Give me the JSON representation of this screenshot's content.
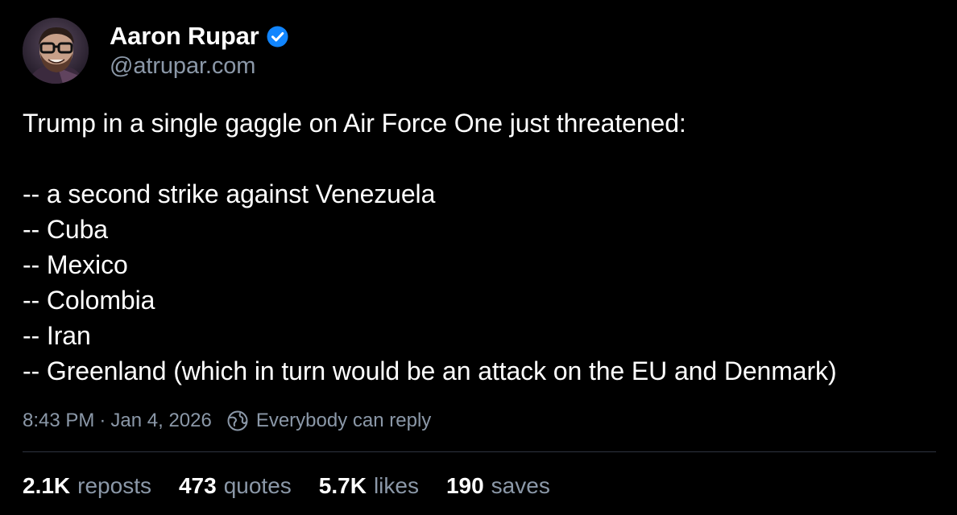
{
  "author": {
    "display_name": "Aaron Rupar",
    "handle": "@atrupar.com",
    "verified": true,
    "verified_color": "#1185fe"
  },
  "post": {
    "lines": [
      "Trump in a single gaggle on Air Force One just threatened:",
      "",
      "-- a second strike against Venezuela",
      "-- Cuba",
      "-- Mexico",
      "-- Colombia",
      "-- Iran",
      "-- Greenland (which in turn would be an attack on the EU and Denmark)"
    ]
  },
  "meta": {
    "time": "8:43 PM",
    "separator": "·",
    "date": "Jan 4, 2026",
    "reply_setting": "Everybody can reply",
    "reply_icon": "globe-icon"
  },
  "stats": {
    "reposts": {
      "count": "2.1K",
      "label": "reposts"
    },
    "quotes": {
      "count": "473",
      "label": "quotes"
    },
    "likes": {
      "count": "5.7K",
      "label": "likes"
    },
    "saves": {
      "count": "190",
      "label": "saves"
    }
  },
  "colors": {
    "background": "#000000",
    "text": "#ffffff",
    "muted": "#8b98a8",
    "divider": "#2e3440"
  }
}
